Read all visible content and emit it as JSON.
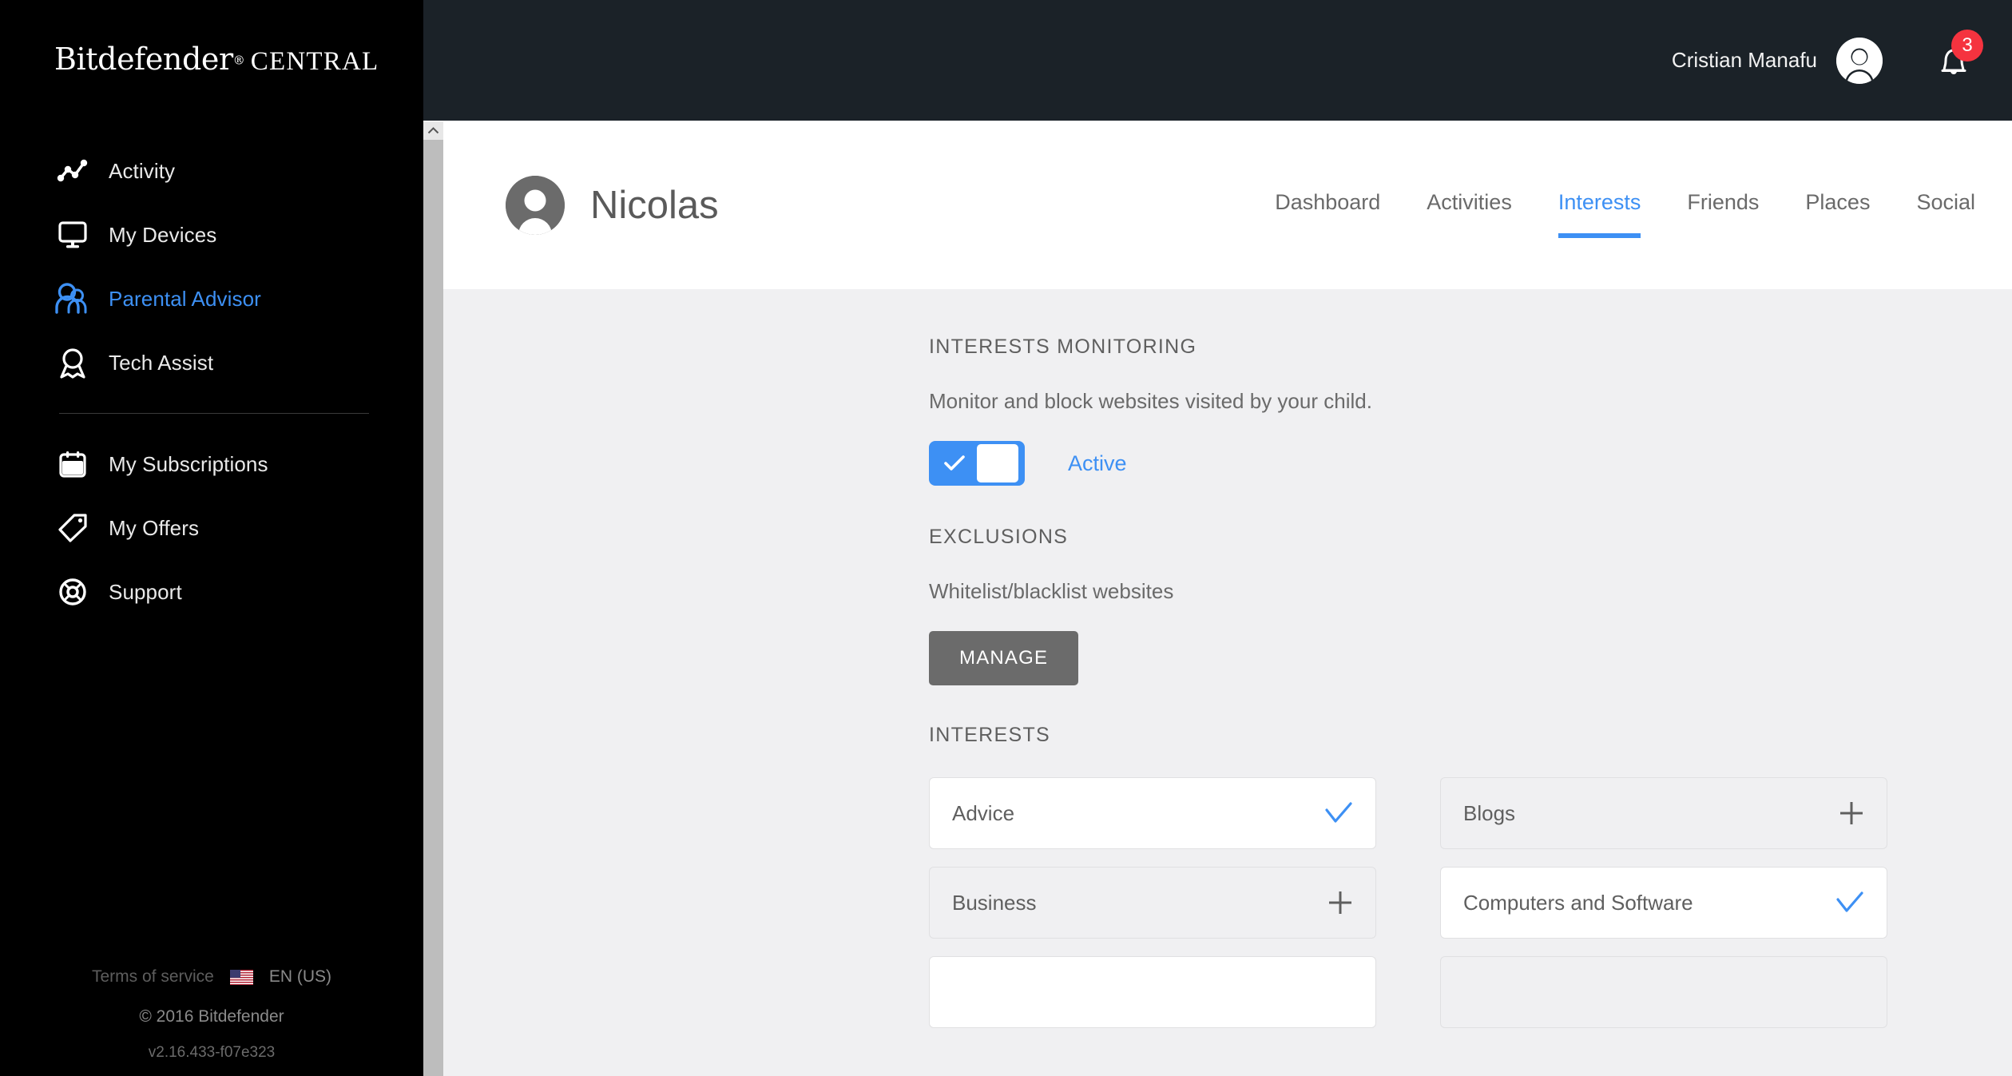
{
  "brand": {
    "name": "Bitdefender",
    "registered": "®",
    "product": "CENTRAL"
  },
  "sidebar": {
    "items": [
      {
        "label": "Activity",
        "icon": "activity-chart-icon",
        "active": false
      },
      {
        "label": "My Devices",
        "icon": "monitor-icon",
        "active": false
      },
      {
        "label": "Parental Advisor",
        "icon": "parent-child-icon",
        "active": true
      },
      {
        "label": "Tech Assist",
        "icon": "award-ribbon-icon",
        "active": false
      }
    ],
    "items_secondary": [
      {
        "label": "My Subscriptions",
        "icon": "calendar-icon",
        "active": false
      },
      {
        "label": "My Offers",
        "icon": "price-tag-icon",
        "active": false
      },
      {
        "label": "Support",
        "icon": "life-ring-icon",
        "active": false
      }
    ],
    "footer": {
      "terms": "Terms of service",
      "language": "EN (US)",
      "flag": "us-flag-icon",
      "copyright": "© 2016 Bitdefender",
      "version": "v2.16.433-f07e323"
    }
  },
  "topbar": {
    "user_name": "Cristian Manafu",
    "avatar": "user-avatar-icon",
    "notifications_icon": "bell-icon",
    "notifications_count": "3"
  },
  "profile": {
    "avatar": "child-avatar-icon",
    "name": "Nicolas",
    "tabs": [
      {
        "label": "Dashboard",
        "active": false
      },
      {
        "label": "Activities",
        "active": false
      },
      {
        "label": "Interests",
        "active": true
      },
      {
        "label": "Friends",
        "active": false
      },
      {
        "label": "Places",
        "active": false
      },
      {
        "label": "Social",
        "active": false
      }
    ]
  },
  "main": {
    "monitoring": {
      "title": "INTERESTS MONITORING",
      "description": "Monitor and block websites visited by your child.",
      "toggle_state": "on",
      "toggle_label": "Active"
    },
    "exclusions": {
      "title": "EXCLUSIONS",
      "description": "Whitelist/blacklist websites",
      "manage_label": "MANAGE"
    },
    "interests": {
      "title": "INTERESTS",
      "cards": [
        {
          "label": "Advice",
          "selected": true
        },
        {
          "label": "Blogs",
          "selected": false
        },
        {
          "label": "Business",
          "selected": false
        },
        {
          "label": "Computers and Software",
          "selected": true
        },
        {
          "label": "",
          "selected": true
        },
        {
          "label": "",
          "selected": false
        }
      ]
    }
  },
  "colors": {
    "accent_blue": "#3d90f4",
    "sidebar_bg": "#000000",
    "topbar_bg": "#1b2228",
    "content_bg": "#f0f0f2",
    "badge_red": "#f5333f",
    "button_gray": "#6b6b6b"
  },
  "scrollbar": {
    "arrow": "chevron-up-icon"
  }
}
